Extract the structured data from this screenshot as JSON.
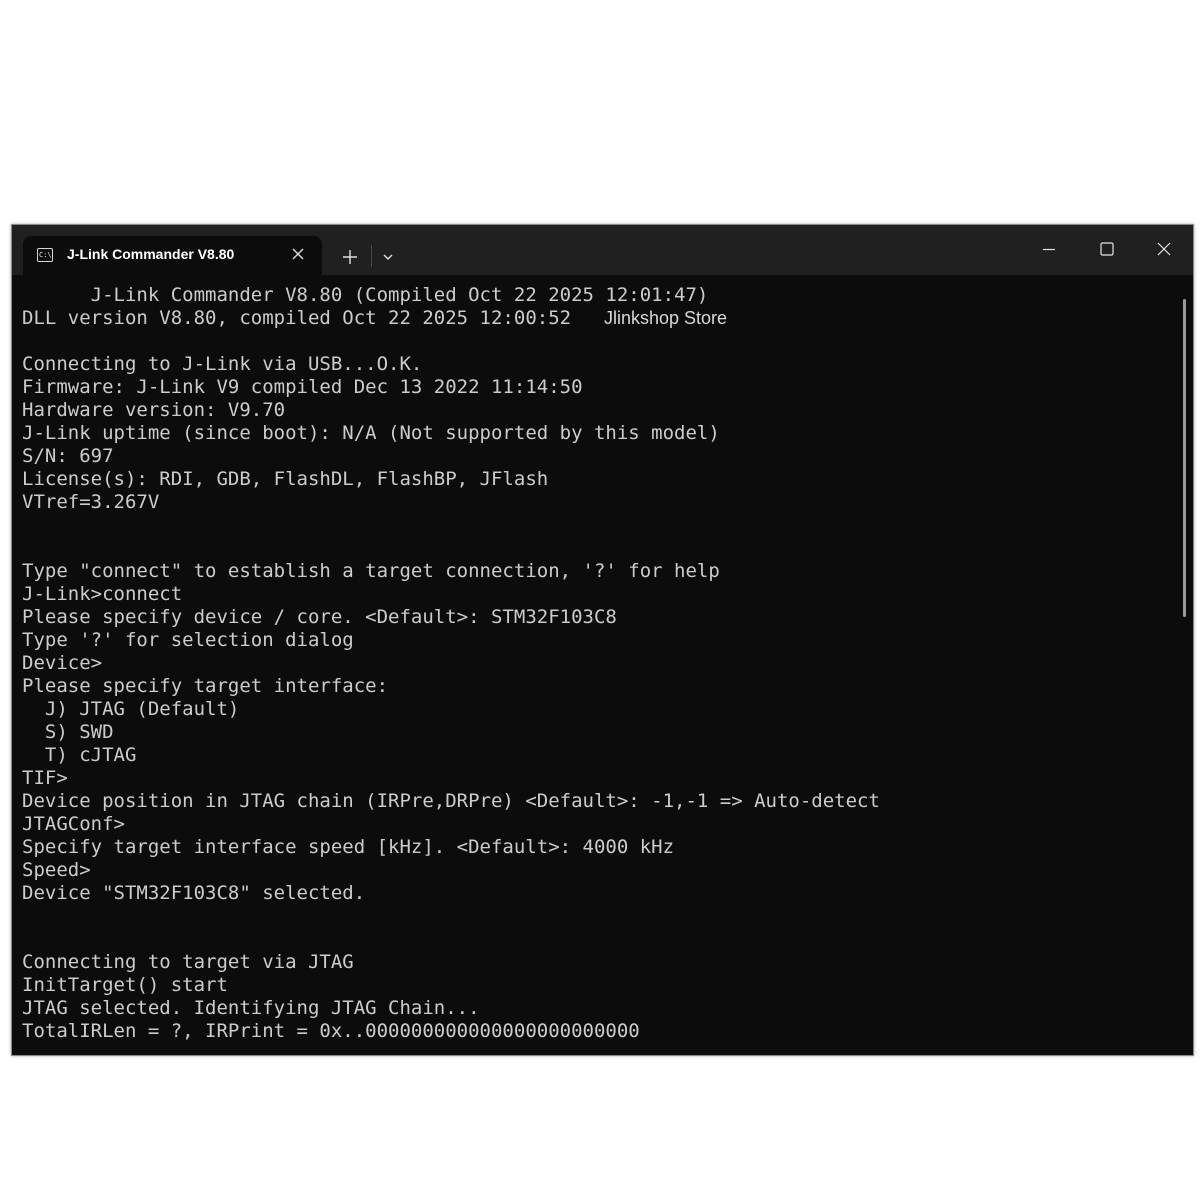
{
  "window": {
    "tab_title": "J-Link Commander V8.80",
    "tab_icon_text": "C:\\"
  },
  "console": {
    "lines": [
      "      J-Link Commander V8.80 (Compiled Oct 22 2025 12:01:47)",
      "DLL version V8.80, compiled Oct 22 2025 12:00:52",
      "",
      "Connecting to J-Link via USB...O.K.",
      "Firmware: J-Link V9 compiled Dec 13 2022 11:14:50",
      "Hardware version: V9.70",
      "J-Link uptime (since boot): N/A (Not supported by this model)",
      "S/N: 697",
      "License(s): RDI, GDB, FlashDL, FlashBP, JFlash",
      "VTref=3.267V",
      "",
      "",
      "Type \"connect\" to establish a target connection, '?' for help",
      "J-Link>connect",
      "Please specify device / core. <Default>: STM32F103C8",
      "Type '?' for selection dialog",
      "Device>",
      "Please specify target interface:",
      "  J) JTAG (Default)",
      "  S) SWD",
      "  T) cJTAG",
      "TIF>",
      "Device position in JTAG chain (IRPre,DRPre) <Default>: -1,-1 => Auto-detect",
      "JTAGConf>",
      "Specify target interface speed [kHz]. <Default>: 4000 kHz",
      "Speed>",
      "Device \"STM32F103C8\" selected.",
      "",
      "",
      "Connecting to target via JTAG",
      "InitTarget() start",
      "JTAG selected. Identifying JTAG Chain...",
      "TotalIRLen = ?, IRPrint = 0x..000000000000000000000000"
    ],
    "watermark": "Jlinkshop Store"
  },
  "icons": {
    "tab_close": "close-icon",
    "new_tab": "plus-icon",
    "dropdown": "chevron-down-icon",
    "minimize": "minimize-icon",
    "maximize": "maximize-icon",
    "close": "close-icon"
  },
  "colors": {
    "background": "#0c0c0c",
    "titlebar": "#202020",
    "text": "#cccccc"
  }
}
